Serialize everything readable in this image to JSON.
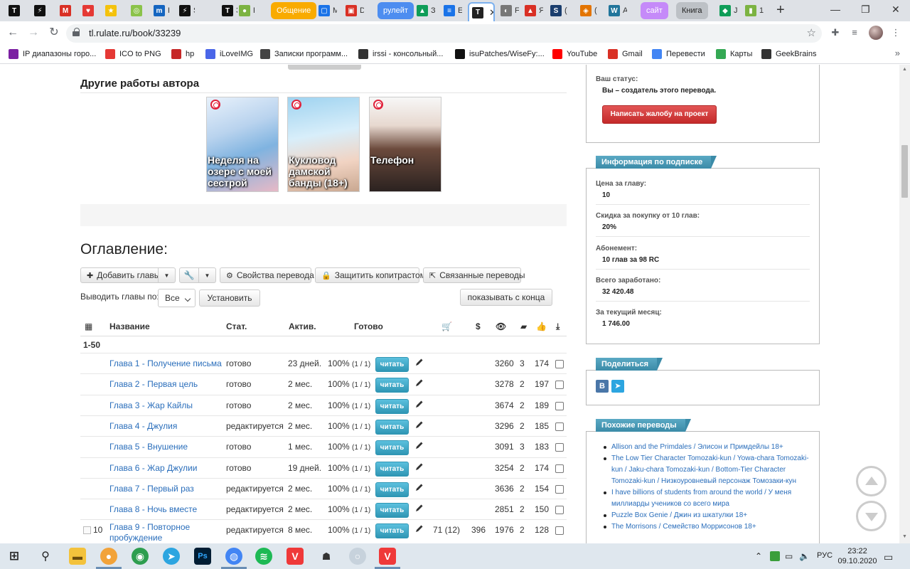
{
  "browser": {
    "tabs": [
      {
        "icon": "T",
        "color": "#111111",
        "label": ""
      },
      {
        "icon": "⚡",
        "color": "#111111",
        "label": ""
      },
      {
        "icon": "M",
        "color": "#d93025",
        "label": ""
      },
      {
        "icon": "♥",
        "color": "#e53935",
        "label": ""
      },
      {
        "icon": "★",
        "color": "#f4c20d",
        "label": ""
      },
      {
        "icon": "◎",
        "color": "#8bc34a",
        "label": ""
      },
      {
        "icon": "m",
        "color": "#1565c0",
        "label": "K"
      },
      {
        "icon": "⚡",
        "color": "#111111",
        "label": "S"
      },
      {
        "icon": "T",
        "color": "#111111",
        "label": "З"
      },
      {
        "icon": "●",
        "color": "#7cb342",
        "label": "F"
      }
    ],
    "chip_tabs": [
      {
        "label": "Общение",
        "color": "#f9ab00",
        "text_color": "#ffffff"
      },
      {
        "label": "рулейт",
        "color": "#4d8df0",
        "text_color": "#ffffff"
      },
      {
        "label": "сайт",
        "color": "#c58af9",
        "text_color": "#ffffff"
      },
      {
        "label": "Книга",
        "color": "#bdc1c6",
        "text_color": "#222222"
      }
    ],
    "mid_tabs_a": [
      {
        "icon": "▢",
        "color": "#1a73e8",
        "label": "M"
      },
      {
        "icon": "▣",
        "color": "#d93025",
        "label": "D"
      }
    ],
    "mid_tabs_b": [
      {
        "icon": "▲",
        "color": "#0f9d58",
        "label": "З"
      },
      {
        "icon": "≡",
        "color": "#1a73e8",
        "label": "E"
      }
    ],
    "active_tab": {
      "label": "Tl",
      "close": "✕"
    },
    "mid_tabs_c": [
      {
        "icon": "◐",
        "color": "#777777",
        "label": "F"
      },
      {
        "icon": "▲",
        "color": "#d93025",
        "label": "Я"
      },
      {
        "icon": "S",
        "color": "#1a3d6d",
        "label": "("
      },
      {
        "icon": "◈",
        "color": "#e37400",
        "label": "("
      },
      {
        "icon": "W",
        "color": "#21759b",
        "label": "A"
      }
    ],
    "end_tabs": [
      {
        "icon": "◆",
        "color": "#0f9d58",
        "label": "J"
      },
      {
        "icon": "▮",
        "color": "#7cb342",
        "label": "1"
      }
    ],
    "new_tab": "+",
    "url": "tl.rulate.ru/book/33239",
    "bookmarks": [
      {
        "label": "IP диапазоны горо...",
        "color": "#7b1fa2"
      },
      {
        "label": "ICO to PNG",
        "color": "#e53935"
      },
      {
        "label": "hp",
        "color": "#c62828"
      },
      {
        "label": "iLoveIMG",
        "color": "#4a66e8"
      },
      {
        "label": "Записки программ...",
        "color": "#444444"
      },
      {
        "label": "irssi - консольный...",
        "color": "#333333"
      },
      {
        "label": "isuPatches/WiseFy:...",
        "color": "#111111"
      },
      {
        "label": "YouTube",
        "color": "#ff0000"
      },
      {
        "label": "Gmail",
        "color": "#d93025"
      },
      {
        "label": "Перевести",
        "color": "#4285f4"
      },
      {
        "label": "Карты",
        "color": "#34a853"
      },
      {
        "label": "GeekBrains",
        "color": "#333333"
      }
    ]
  },
  "other_works": {
    "heading": "Другие работы автора",
    "covers": [
      {
        "title": "Неделя на озере с моей сестрой",
        "bg": "linear-gradient(160deg,#e8f1fb 0%,#b9d3ee 35%,#7fb3e0 60%,#e7b9c6 100%)"
      },
      {
        "title": "Кукловод дамской банды (18+)",
        "bg": "linear-gradient(170deg,#9fd3f0 0%,#d8eefa 40%,#f1d3c2 70%,#c9a891 100%)"
      },
      {
        "title": "Телефон",
        "bg": "linear-gradient(180deg,#f7f7f7 0%,#e7d8cf 30%,#6b4a3c 55%,#2b2220 100%)"
      }
    ]
  },
  "toc": {
    "title": "Оглавление:",
    "add_chapters": "Добавить главы",
    "properties": "Свойства перевода",
    "protect": "Защитить копитрастом",
    "related": "Связанные переводы",
    "show_by_label": "Выводить главы по:",
    "show_by_value": "Все",
    "set_button": "Установить",
    "show_from_end": "показывать с конца",
    "headers": {
      "name": "Название",
      "status": "Стат.",
      "active": "Актив.",
      "ready": "Готово"
    },
    "group": "1-50",
    "read_label": "читать",
    "rows": [
      {
        "num": "",
        "title": "Глава 1 - Получение письма",
        "status": "готово",
        "active": "23 дней.",
        "ready": "100%",
        "ready_sub": "(1 / 1)",
        "buys": "",
        "money": "",
        "views": "3260",
        "comments": "3",
        "likes": "174"
      },
      {
        "num": "",
        "title": "Глава 2 - Первая цель",
        "status": "готово",
        "active": "2 мес.",
        "ready": "100%",
        "ready_sub": "(1 / 1)",
        "buys": "",
        "money": "",
        "views": "3278",
        "comments": "2",
        "likes": "197"
      },
      {
        "num": "",
        "title": "Глава 3 - Жар Кайлы",
        "status": "готово",
        "active": "2 мес.",
        "ready": "100%",
        "ready_sub": "(1 / 1)",
        "buys": "",
        "money": "",
        "views": "3674",
        "comments": "2",
        "likes": "189"
      },
      {
        "num": "",
        "title": "Глава 4 - Джулия",
        "status": "редактируется",
        "active": "2 мес.",
        "ready": "100%",
        "ready_sub": "(1 / 1)",
        "buys": "",
        "money": "",
        "views": "3296",
        "comments": "2",
        "likes": "185"
      },
      {
        "num": "",
        "title": "Глава 5 - Внушение",
        "status": "готово",
        "active": "1 мес.",
        "ready": "100%",
        "ready_sub": "(1 / 1)",
        "buys": "",
        "money": "",
        "views": "3091",
        "comments": "3",
        "likes": "183"
      },
      {
        "num": "",
        "title": "Глава 6 - Жар Джулии",
        "status": "готово",
        "active": "19 дней.",
        "ready": "100%",
        "ready_sub": "(1 / 1)",
        "buys": "",
        "money": "",
        "views": "3254",
        "comments": "2",
        "likes": "174"
      },
      {
        "num": "",
        "title": "Глава 7 - Первый раз",
        "status": "редактируется",
        "active": "2 мес.",
        "ready": "100%",
        "ready_sub": "(1 / 1)",
        "buys": "",
        "money": "",
        "views": "3636",
        "comments": "2",
        "likes": "154"
      },
      {
        "num": "",
        "title": "Глава 8 - Ночь вместе",
        "status": "редактируется",
        "active": "2 мес.",
        "ready": "100%",
        "ready_sub": "(1 / 1)",
        "buys": "",
        "money": "",
        "views": "2851",
        "comments": "2",
        "likes": "150"
      },
      {
        "num": "10",
        "title": "Глава 9 - Повторное пробуждение",
        "status": "редактируется",
        "active": "8 мес.",
        "ready": "100%",
        "ready_sub": "(1 / 1)",
        "buys": "71 (12)",
        "money": "396",
        "views": "1976",
        "comments": "2",
        "likes": "128"
      }
    ]
  },
  "sidebar": {
    "status_label": "Ваш статус:",
    "status_value": "Вы – создатель этого перевода.",
    "complaint_button": "Написать жалобу на проект",
    "subscription_title": "Информация по подписке",
    "sub_items": [
      {
        "label": "Цена за главу:",
        "value": "10"
      },
      {
        "label": "Скидка за покупку от 10 глав:",
        "value": "20%"
      },
      {
        "label": "Абонемент:",
        "value": "10 глав за 98 RC"
      },
      {
        "label": "Всего заработано:",
        "value": "32 420.48"
      },
      {
        "label": "За текущий месяц:",
        "value": "1 746.00"
      }
    ],
    "share_title": "Поделиться",
    "share_vk": "В",
    "share_tg": "➤",
    "similar_title": "Похожие переводы",
    "similar": [
      "Allison and the Primdales / Элисон и Примдейлы 18+",
      "The Low Tier Character Tomozaki-kun / Yowa-chara Tomozaki-kun / Jaku-chara Tomozaki-kun / Bottom-Tier Character Tomozaki-kun / Низкоуровневый персонаж Томозаки-кун",
      "I have billions of students from around the world / У меня миллиарды учеников со всего мира",
      "Puzzle Box Genie / Джин из шкатулки 18+",
      "The Morrisons / Семейство Моррисонов 18+"
    ]
  },
  "taskbar": {
    "tray_lang": "РУС",
    "time": "23:22",
    "date": "09.10.2020"
  }
}
